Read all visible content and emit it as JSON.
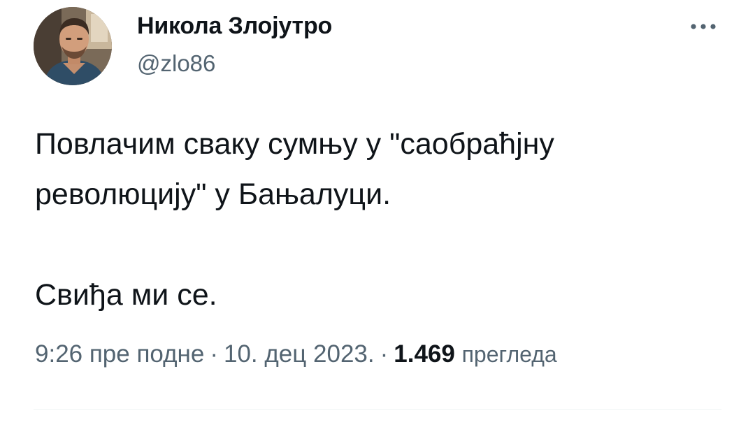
{
  "author": {
    "name": "Никола Злојутро",
    "handle": "@zlo86"
  },
  "tweet": {
    "paragraph1": "Повлачим сваку сумњу у \"саобраћјну революцију\" у Бањалуци.",
    "paragraph2": "Свиђа ми се."
  },
  "meta": {
    "time": "9:26 пре подне",
    "separator": "·",
    "date": "10. дец 2023.",
    "views_count": "1.469",
    "views_label": "прегледа"
  },
  "icons": {
    "more": "more-horizontal-icon"
  },
  "colors": {
    "text": "#0f1419",
    "secondary": "#536471",
    "divider": "#eff3f4"
  }
}
